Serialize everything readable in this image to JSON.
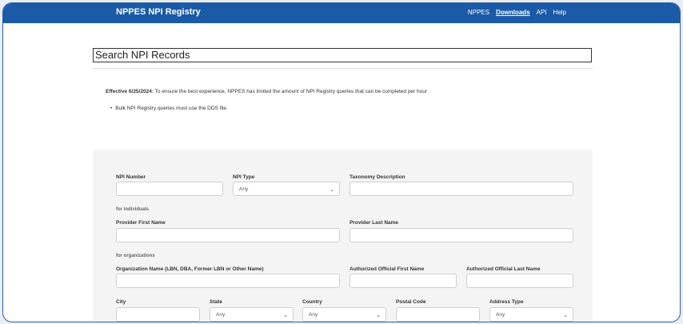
{
  "header": {
    "brand": "NPPES NPI Registry",
    "nav": [
      "NPPES",
      "Downloads",
      "API",
      "Help"
    ]
  },
  "page_title": "Search NPI Records",
  "notice": {
    "bold": "Effective 6/25/2024:",
    "text": " To ensure the best experience, NPPES has limited the amount of NPI Registry queries that can be completed per hour",
    "bullet": "Bulk NPI Registry queries must use the DDS file."
  },
  "form": {
    "npi_number_label": "NPI Number",
    "npi_type_label": "NPI Type",
    "npi_type_value": "Any",
    "taxonomy_label": "Taxonomy Description",
    "individuals_heading": "for individuals",
    "first_name_label": "Provider First Name",
    "last_name_label": "Provider Last Name",
    "organizations_heading": "for organizations",
    "org_name_label": "Organization Name (LBN, DBA, Former LBN or Other Name)",
    "auth_first_label": "Authorized Official First Name",
    "auth_last_label": "Authorized Official Last Name",
    "city_label": "City",
    "state_label": "State",
    "state_value": "Any",
    "country_label": "Country",
    "country_value": "Any",
    "postal_label": "Postal Code",
    "address_type_label": "Address Type",
    "address_type_value": "Any"
  },
  "colors": {
    "header_bg": "#1a5aa7",
    "panel_bg": "#f4f4f4"
  }
}
